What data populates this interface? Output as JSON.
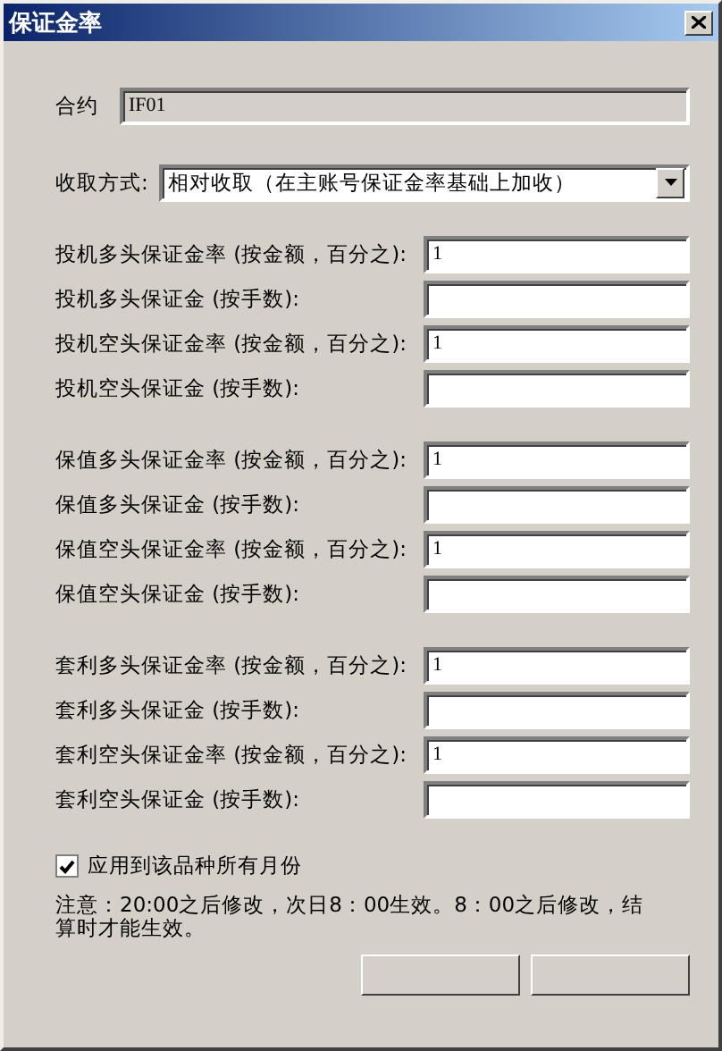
{
  "window": {
    "title": "保证金率"
  },
  "contract": {
    "label": "合约",
    "value": "IF01"
  },
  "charge_method": {
    "label": "收取方式:",
    "value": "相对收取（在主账号保证金率基础上加收）"
  },
  "groups": [
    {
      "fields": [
        {
          "label": "投机多头保证金率 (按金额，百分之):",
          "value": "1"
        },
        {
          "label": "投机多头保证金 (按手数):"
        },
        {
          "label": "投机空头保证金率 (按金额，百分之):",
          "value": "1"
        },
        {
          "label": "投机空头保证金 (按手数):"
        }
      ]
    },
    {
      "fields": [
        {
          "label": "保值多头保证金率 (按金额，百分之):",
          "value": "1"
        },
        {
          "label": "保值多头保证金 (按手数):"
        },
        {
          "label": "保值空头保证金率 (按金额，百分之):",
          "value": "1"
        },
        {
          "label": "保值空头保证金 (按手数):"
        }
      ]
    },
    {
      "fields": [
        {
          "label": "套利多头保证金率 (按金额，百分之):",
          "value": "1"
        },
        {
          "label": "套利多头保证金 (按手数):"
        },
        {
          "label": "套利空头保证金率 (按金额，百分之):",
          "value": "1"
        },
        {
          "label": "套利空头保证金 (按手数):"
        }
      ]
    }
  ],
  "apply_all": {
    "label": "应用到该品种所有月份",
    "checked": true
  },
  "note": "注意：20:00之后修改，次日8：00生效。8：00之后修改，结算时才能生效。"
}
